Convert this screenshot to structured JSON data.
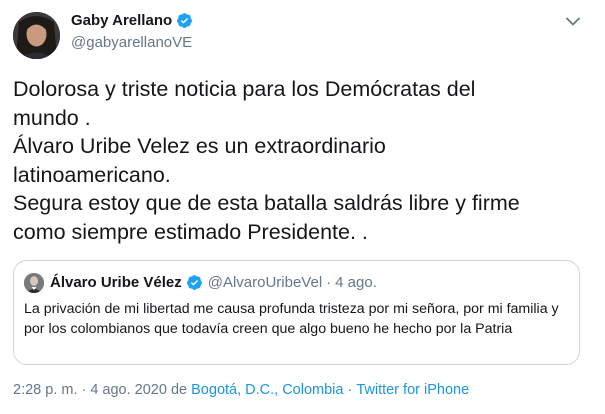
{
  "author": {
    "display_name": "Gaby Arellano",
    "handle": "@gabyarellanoVE",
    "verified": true
  },
  "tweet": {
    "lines": [
      "Dolorosa y triste noticia para los Demócratas del",
      "mundo .",
      "Álvaro Uribe Velez es un extraordinario",
      "latinoamericano.",
      "Segura estoy que de esta batalla saldrás libre y firme",
      "como siempre estimado Presidente. ."
    ]
  },
  "quote": {
    "display_name": "Álvaro Uribe Vélez",
    "handle": "@AlvaroUribeVel",
    "separator": "·",
    "time": "4 ago.",
    "verified": true,
    "text": "La privación de mi libertad me causa profunda tristeza por mi señora, por mi familia y por los colombianos que todavía creen que algo bueno he hecho por la Patria"
  },
  "meta": {
    "time": "2:28 p. m.",
    "dot": "·",
    "date": "4 ago. 2020",
    "from_label": "de",
    "location": "Bogotá, D.C., Colombia",
    "source": "Twitter for iPhone"
  },
  "colors": {
    "accent": "#1da1f2",
    "link": "#1b95e0",
    "secondary_text": "#657786",
    "border": "#ccd6dd"
  },
  "icons": {
    "verified": "verified-badge-icon",
    "menu": "chevron-down-icon"
  }
}
